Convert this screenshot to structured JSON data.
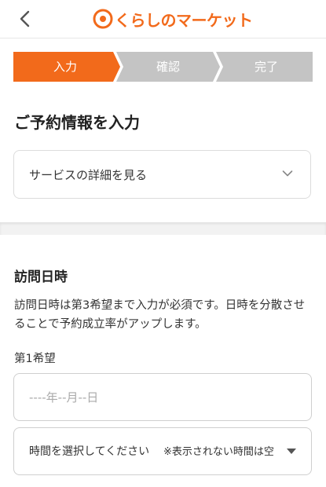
{
  "header": {
    "back_icon": "chevron-left-icon",
    "logo_text": "くらしのマーケット",
    "brand_color": "#f26a1b"
  },
  "steps": [
    {
      "label": "入力",
      "active": true
    },
    {
      "label": "確認",
      "active": false
    },
    {
      "label": "完了",
      "active": false
    }
  ],
  "step_colors": {
    "active": "#f26a1b",
    "inactive": "#c4c4c4"
  },
  "page_title": "ご予約情報を入力",
  "service_details": {
    "label": "サービスの詳細を見る",
    "icon": "chevron-down-icon"
  },
  "visit_section": {
    "title": "訪問日時",
    "description": "訪問日時は第3希望まで入力が必須です。日時を分散させることで予約成立率がアップします。",
    "preference_label": "第1希望",
    "date_placeholder": "----年--月--日",
    "time_select_label": "時間を選択してください",
    "time_select_note": "※表示されない時間は空",
    "time_select_icon": "caret-down-icon"
  }
}
